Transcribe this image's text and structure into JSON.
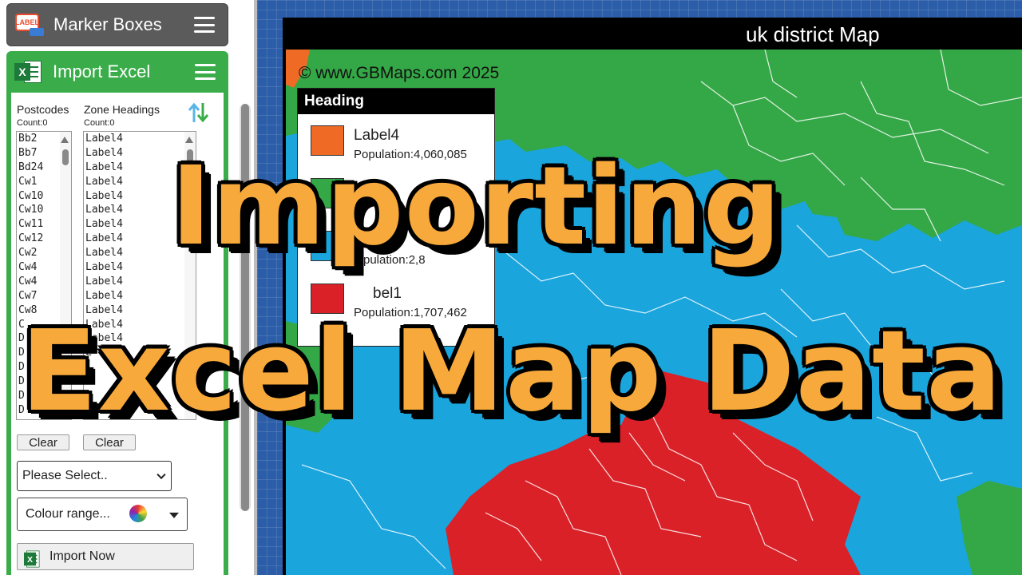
{
  "sidebar": {
    "marker_panel": {
      "title": "Marker Boxes",
      "icon": "label-icon",
      "icon_text": "LABEL"
    },
    "excel_panel": {
      "title": "Import Excel",
      "icon": "excel-icon",
      "icon_letter": "X",
      "postcodes": {
        "heading": "Postcodes",
        "count": "Count:0",
        "items": [
          "Bb2",
          "Bb7",
          "Bd24",
          "Cw1",
          "Cw10",
          "Cw10",
          "Cw11",
          "Cw12",
          "Cw2",
          "Cw4",
          "Cw4",
          "Cw7",
          "Cw8",
          "C",
          "D",
          "D",
          "D",
          "D",
          "D",
          "D"
        ]
      },
      "zone_headings": {
        "heading": "Zone Headings",
        "count": "Count:0",
        "items": [
          "Label4",
          "Label4",
          "Label4",
          "Label4",
          "Label4",
          "Label4",
          "Label4",
          "Label4",
          "Label4",
          "Label4",
          "Label4",
          "Label4",
          "Label4",
          "Label4",
          "Label4",
          "L",
          "L",
          "L",
          "L",
          "L"
        ]
      },
      "clear_postcodes_label": "Clear",
      "clear_zones_label": "Clear",
      "select_value": "Please Select..",
      "colour_range_label": "Colour range...",
      "import_now_label": "Import Now"
    }
  },
  "map": {
    "title": "uk district Map",
    "copyright": "© www.GBMaps.com 2025",
    "colors": {
      "orange": "#ef6a25",
      "green": "#34a846",
      "blue": "#1aa5dd",
      "red": "#da2128"
    },
    "legend": {
      "heading": "Heading",
      "items": [
        {
          "label": "Label4",
          "population": "Population:4,060,085",
          "color": "#ef6a25"
        },
        {
          "label": "",
          "population": "",
          "color": "#34a846"
        },
        {
          "label": "",
          "population": "pulation:2,8",
          "color": "#1aa5dd"
        },
        {
          "label": "bel1",
          "population": "Population:1,707,462",
          "color": "#da2128"
        }
      ]
    }
  },
  "overlay": {
    "line1": "Importing",
    "line2": "Excel Map Data",
    "text_color": "#f7a93b"
  }
}
